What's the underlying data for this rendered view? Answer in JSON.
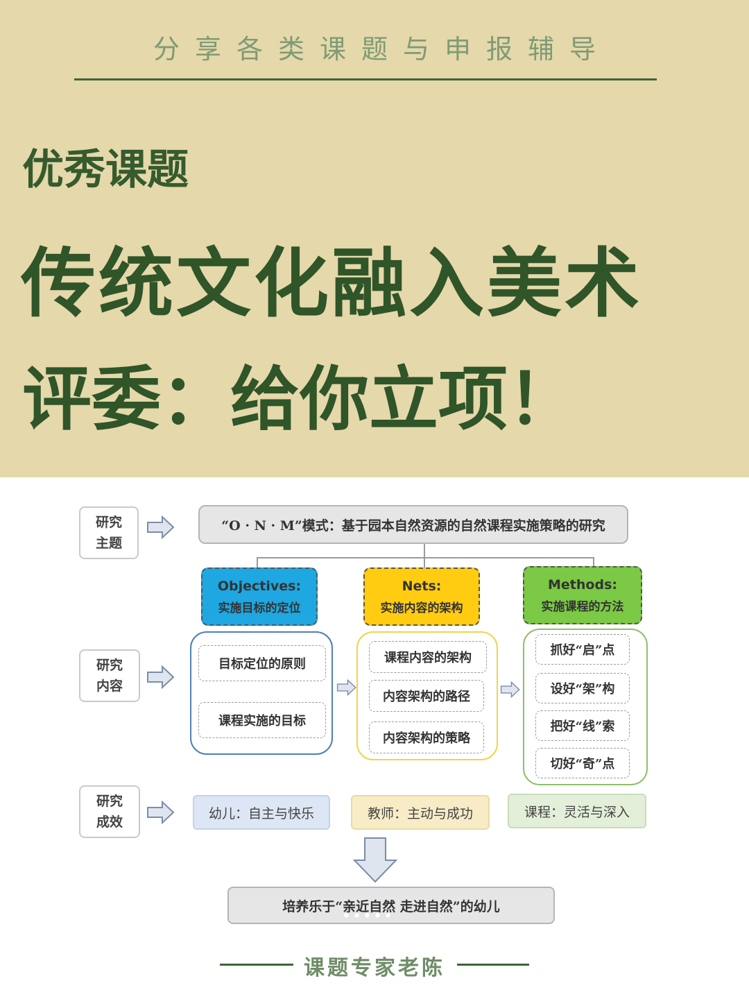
{
  "header": {
    "tagline": "分享各类课题与申报辅导",
    "label": "优秀课题",
    "headline": "传统文化融入美术",
    "subline": "评委：给你立项！"
  },
  "diagram": {
    "row_labels": {
      "topic": "研究\n主题",
      "content": "研究\n内容",
      "results": "研究\n成效"
    },
    "topic": "“O · N · M”模式：基于园本自然资源的自然课程实施策略的研究",
    "columns": [
      {
        "en": "Objectives:",
        "zh": "实施目标的定位",
        "color": "#1ea7e1",
        "items": [
          "目标定位的原则",
          "课程实施的目标"
        ],
        "result": "幼儿：自主与快乐"
      },
      {
        "en": "Nets:",
        "zh": "实施内容的架构",
        "color": "#ffcc12",
        "items": [
          "课程内容的架构",
          "内容架构的路径",
          "内容架构的策略"
        ],
        "result": "教师：主动与成功"
      },
      {
        "en": "Methods:",
        "zh": "实施课程的方法",
        "color": "#7bc944",
        "items": [
          "抓好“启”点",
          "设好“架”构",
          "把好“线”索",
          "切好“奇”点"
        ],
        "result": "课程：灵活与深入"
      }
    ],
    "final": "培养乐于“亲近自然 走进自然”的幼儿"
  },
  "footer": {
    "signature": "课题专家老陈"
  },
  "colors": {
    "banner_bg": "#e5d8aa",
    "headline": "#2f5529",
    "accent_line": "#3f6438"
  }
}
